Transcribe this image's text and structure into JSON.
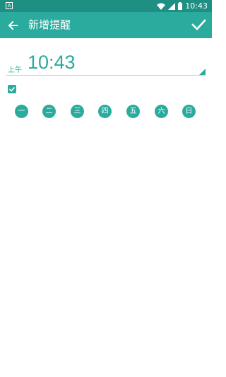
{
  "status_bar": {
    "left_icon_label": "A",
    "time": "10:43",
    "icons": [
      "wifi-icon",
      "signal-icon",
      "battery-icon"
    ]
  },
  "app_bar": {
    "title": "新增提醒",
    "back_icon": "arrow-left-icon",
    "confirm_icon": "checkmark-icon"
  },
  "time": {
    "ampm": "上午",
    "value": "10:43"
  },
  "enabled_checked": true,
  "days": [
    {
      "label": "一"
    },
    {
      "label": "二"
    },
    {
      "label": "三"
    },
    {
      "label": "四"
    },
    {
      "label": "五"
    },
    {
      "label": "六"
    },
    {
      "label": "日"
    }
  ],
  "colors": {
    "status_bar": "#1f8f83",
    "accent": "#2bab9d"
  }
}
